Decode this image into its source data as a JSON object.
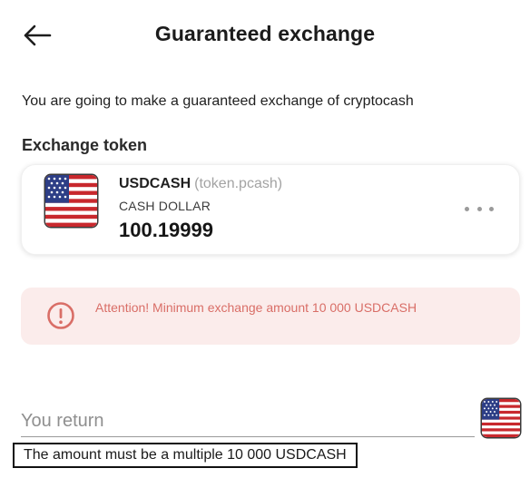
{
  "header": {
    "title": "Guaranteed exchange",
    "back_icon": "arrow-left-icon"
  },
  "intro": "You are going to make a guaranteed exchange of cryptocash",
  "exchange_token": {
    "label": "Exchange token",
    "symbol": "USDCASH",
    "token_id": "(token.pcash)",
    "name": "CASH DOLLAR",
    "balance": "100.19999",
    "flag_icon": "us-flag-icon",
    "more_icon": "more-horizontal-icon"
  },
  "alert": {
    "icon": "exclamation-circle-icon",
    "text": "Attention! Minimum exchange amount 10 000 USDCASH",
    "color": "#d96e67",
    "background": "#fbeceb"
  },
  "return": {
    "placeholder": "You return",
    "value": "",
    "flag_icon": "us-flag-icon"
  },
  "hint": "The amount must be a multiple 10 000 USDCASH"
}
